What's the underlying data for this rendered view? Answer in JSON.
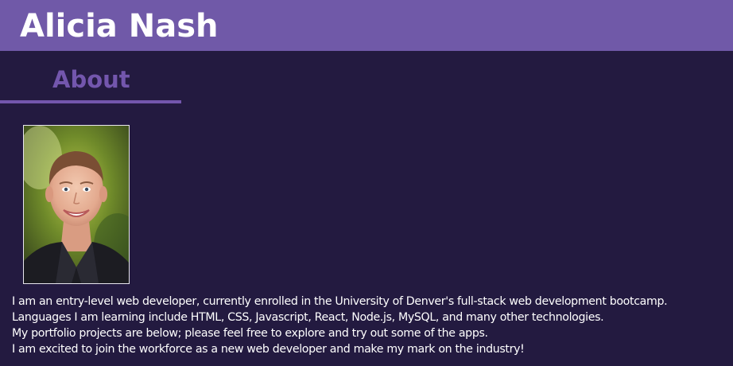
{
  "header": {
    "title": "Alicia Nash"
  },
  "about": {
    "heading": "About",
    "photo_icon": "portrait-photo",
    "bio_lines": [
      "I am an entry-level web developer, currently enrolled in the University of Denver's full-stack web development bootcamp.",
      "Languages I am learning include HTML, CSS, Javascript, React, Node.js, MySQL, and many other technologies.",
      "My portfolio projects are below; please feel free to explore and try out some of the apps.",
      "I am excited to join the workforce as a new web developer and make my mark on the industry!"
    ]
  },
  "colors": {
    "background": "#231a40",
    "header": "#7059a8",
    "accent": "#7356ad",
    "text": "#ffffff"
  }
}
